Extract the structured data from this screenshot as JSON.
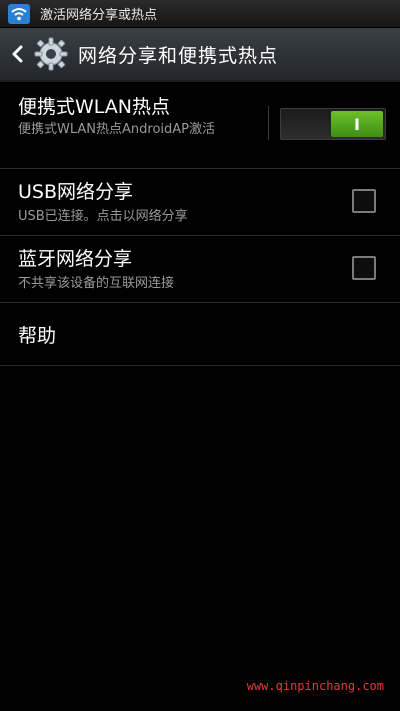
{
  "status_bar": {
    "notification_text": "激活网络分享或热点"
  },
  "action_bar": {
    "title": "网络分享和便携式热点"
  },
  "settings": {
    "wlan_hotspot": {
      "title": "便携式WLAN热点",
      "summary": "便携式WLAN热点AndroidAP激活",
      "toggle_label": "I",
      "enabled": true
    },
    "usb_tethering": {
      "title": "USB网络分享",
      "summary": "USB已连接。点击以网络分享",
      "checked": false
    },
    "bluetooth_tethering": {
      "title": "蓝牙网络分享",
      "summary": "不共享该设备的互联网连接",
      "checked": false
    },
    "help": {
      "title": "帮助"
    }
  },
  "watermark": "www.qinpinchang.com",
  "colors": {
    "background": "#000000",
    "toggle_on": "#5cb323",
    "summary_text": "#9a9a9a",
    "watermark": "#e53a3a"
  }
}
